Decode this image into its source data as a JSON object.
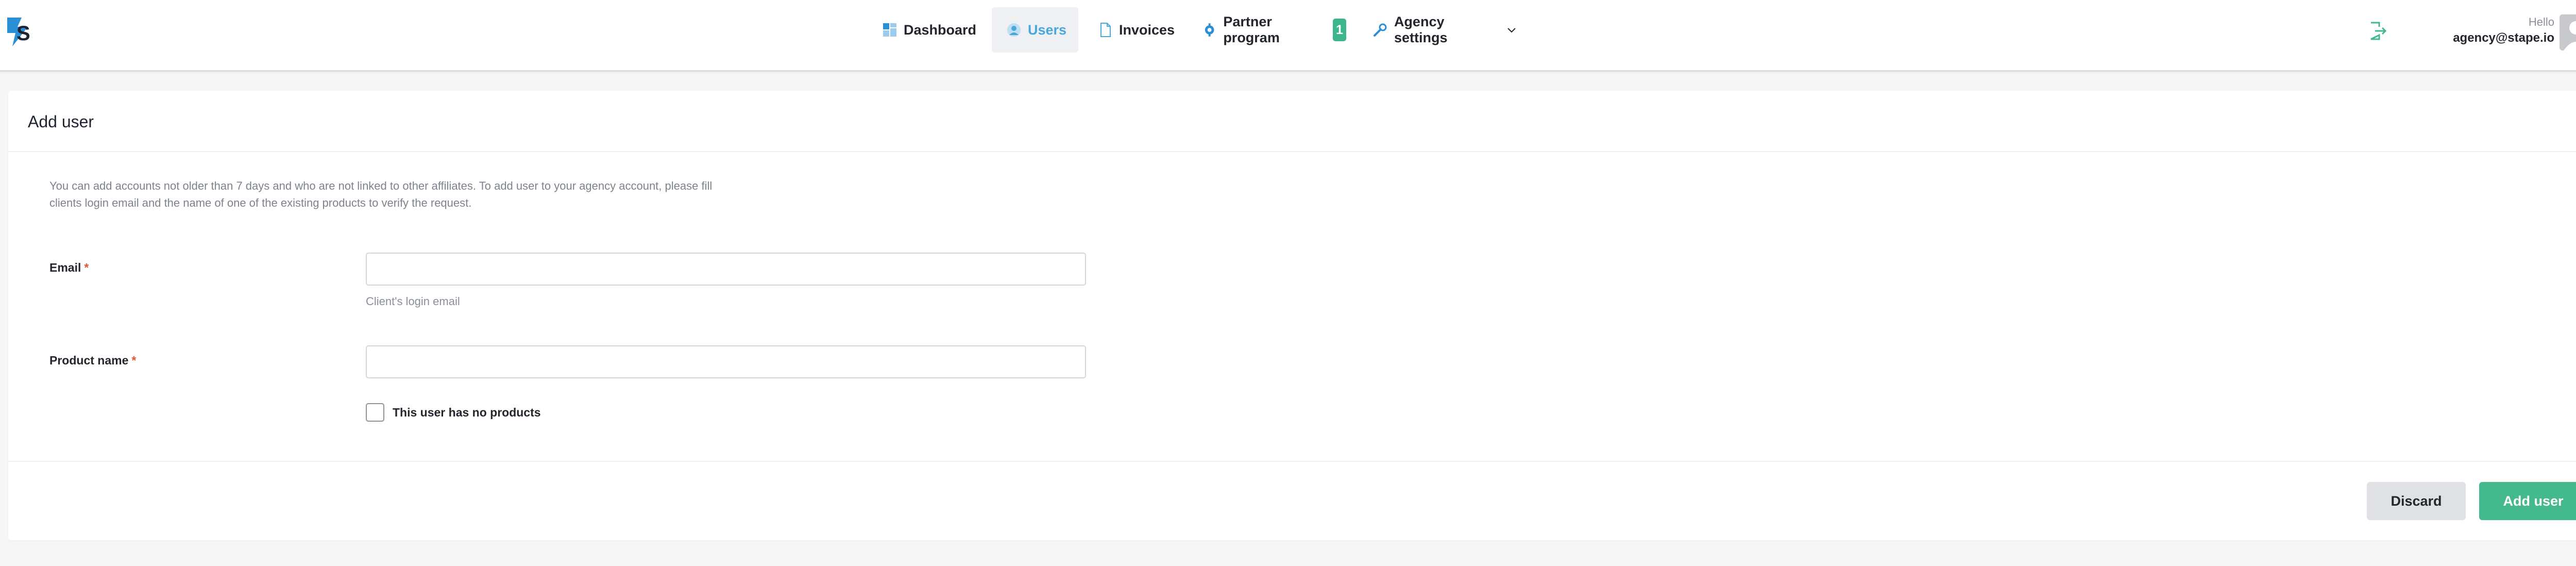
{
  "header": {
    "nav": [
      {
        "label": "Dashboard",
        "icon": "dashboard-icon"
      },
      {
        "label": "Users",
        "icon": "users-icon",
        "active": true
      },
      {
        "label": "Invoices",
        "icon": "invoice-icon"
      },
      {
        "label": "Partner program",
        "icon": "partner-icon",
        "badge": "1"
      },
      {
        "label": "Agency settings",
        "icon": "wrench-icon",
        "dropdown": true
      }
    ],
    "hello": "Hello",
    "email": "agency@stape.io"
  },
  "card": {
    "title": "Add user",
    "description": "You can add accounts not older than 7 days and who are not linked to other affiliates. To add user to your agency account, please fill clients login email and the name of one of the existing products to verify the request.",
    "email_label": "Email",
    "email_value": "",
    "email_hint": "Client's login email",
    "product_label": "Product name",
    "product_value": "",
    "required_mark": "*",
    "checkbox_label": "This user has no products",
    "checkbox_checked": false,
    "discard_label": "Discard",
    "add_label": "Add user"
  },
  "colors": {
    "accent_blue": "#4aa7dc",
    "primary_green": "#43b98d",
    "badge_green": "#3db68c",
    "required_red": "#e4572e"
  }
}
